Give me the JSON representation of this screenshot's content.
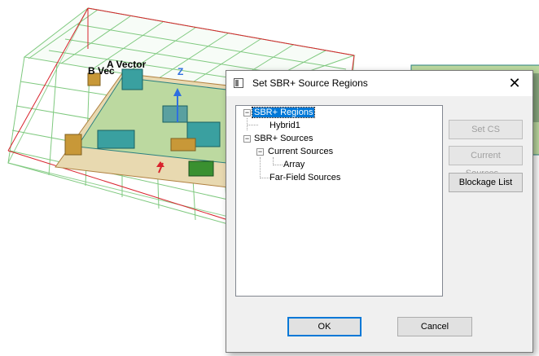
{
  "viewport": {
    "vector_label_a": "A Vector",
    "vector_label_b": "B Vec",
    "axis_label": "Z"
  },
  "dialog": {
    "title": "Set SBR+ Source Regions",
    "close_glyph": "✕",
    "tree": {
      "regions": {
        "label": "SBR+ Regions",
        "expander": "−",
        "children": [
          "Hybrid1"
        ]
      },
      "sources": {
        "label": "SBR+ Sources",
        "expander": "−",
        "current": {
          "label": "Current Sources",
          "expander": "−",
          "children": [
            "Array"
          ]
        },
        "far_field": "Far-Field Sources"
      }
    },
    "buttons": {
      "set_cs": "Set CS",
      "current_sources": "Current Sources...",
      "blockage_list": "Blockage List",
      "ok": "OK",
      "cancel": "Cancel"
    }
  }
}
